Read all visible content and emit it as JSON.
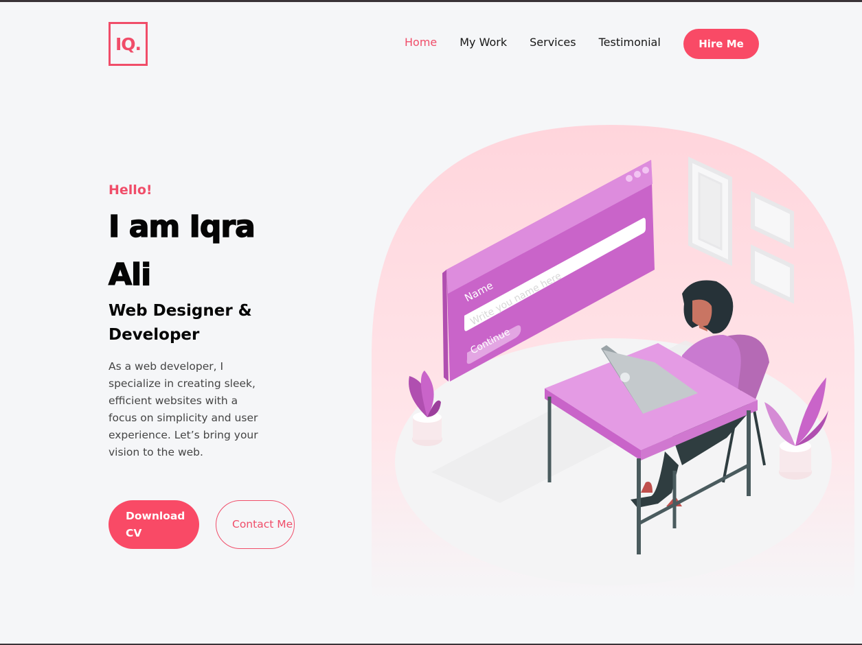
{
  "header": {
    "logo": "IQ.",
    "nav": [
      {
        "label": "Home",
        "active": true
      },
      {
        "label": "My Work",
        "active": false
      },
      {
        "label": "Services",
        "active": false
      },
      {
        "label": "Testimonial",
        "active": false
      }
    ],
    "hire_label": "Hire Me"
  },
  "hero": {
    "greeting": "Hello!",
    "name": "I am Iqra Ali",
    "role": "Web Designer & Developer",
    "description": "As a web developer, I specialize in creating sleek, efficient websites with a focus on simplicity and user experience. Let’s bring your vision to the web.",
    "download_label": "Download CV",
    "contact_label": "Contact Me"
  },
  "illustration": {
    "form_label": "Name",
    "form_placeholder": "Write you name here",
    "form_button": "Continue"
  },
  "colors": {
    "accent": "#f94a66",
    "background": "#f5f6f8",
    "purple": "#d06ad0"
  }
}
